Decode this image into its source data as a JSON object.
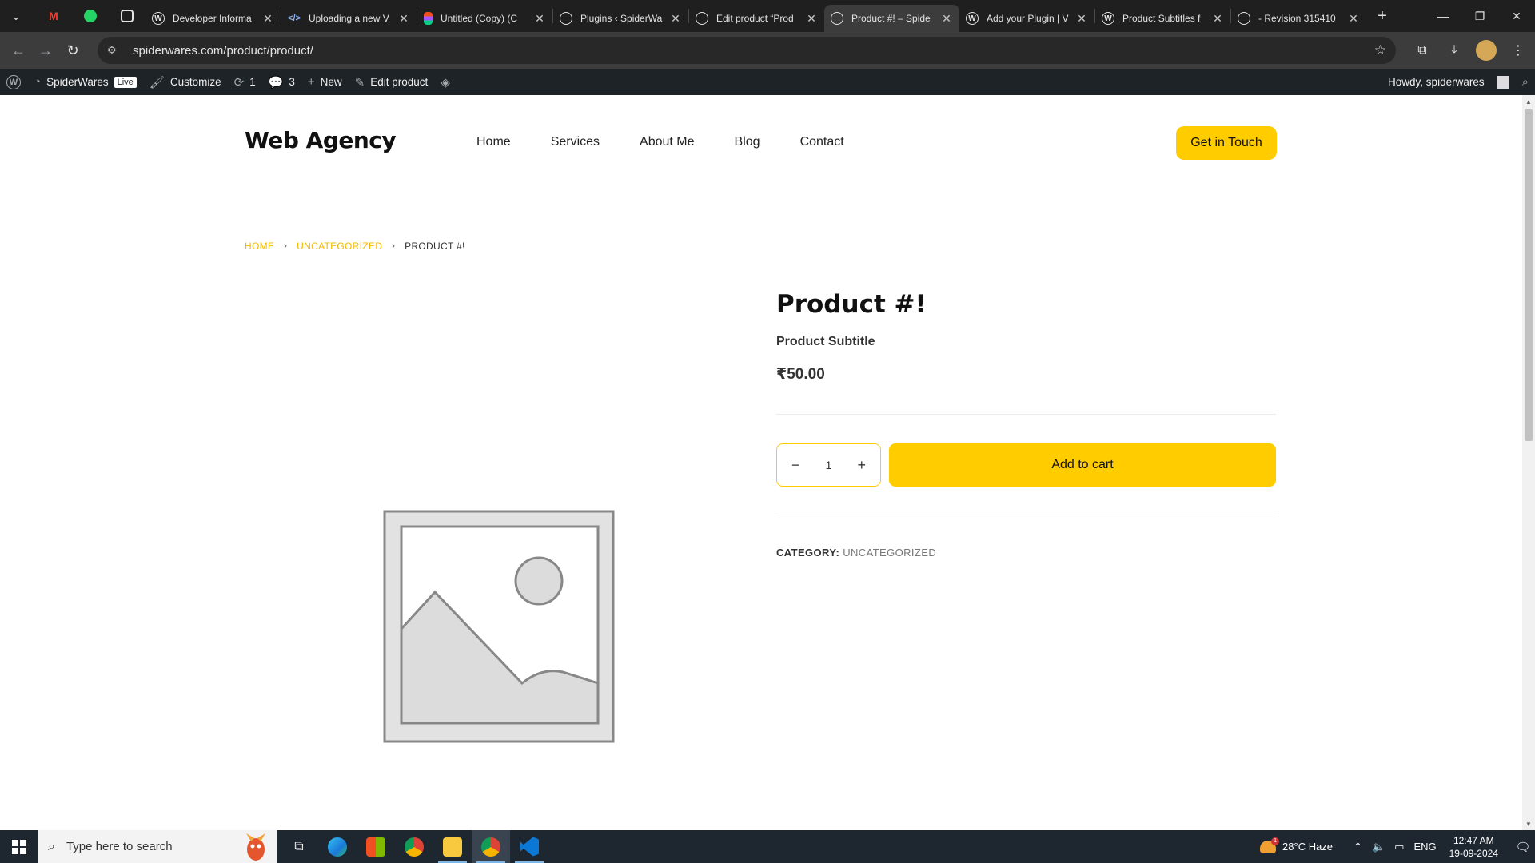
{
  "browser": {
    "tabs": [
      {
        "title": "",
        "type": "pinned",
        "icon": "gmail-icon"
      },
      {
        "title": "",
        "type": "pinned",
        "icon": "whatsapp-icon"
      },
      {
        "title": "",
        "type": "pinned",
        "icon": "chatgpt-icon"
      },
      {
        "title": "Developer Informa",
        "icon": "wordpress-icon"
      },
      {
        "title": "Uploading a new V",
        "icon": "code-icon"
      },
      {
        "title": "Untitled (Copy) (C",
        "icon": "figma-icon"
      },
      {
        "title": "Plugins ‹ SpiderWa",
        "icon": "globe-icon"
      },
      {
        "title": "Edit product “Prod",
        "icon": "globe-icon"
      },
      {
        "title": "Product #! – Spide",
        "icon": "globe-icon",
        "active": true
      },
      {
        "title": "Add your Plugin | V",
        "icon": "wordpress-icon"
      },
      {
        "title": "Product Subtitles f",
        "icon": "wordpress-icon"
      },
      {
        "title": "- Revision 315410",
        "icon": "globe-icon"
      }
    ],
    "url": "spiderwares.com/product/product/"
  },
  "adminbar": {
    "site_name": "SpiderWares",
    "live_badge": "Live",
    "customize": "Customize",
    "updates_count": "1",
    "comments_count": "3",
    "new_label": "New",
    "edit_label": "Edit product",
    "howdy": "Howdy, spiderwares"
  },
  "site": {
    "logo": "Web Agency",
    "nav": [
      "Home",
      "Services",
      "About Me",
      "Blog",
      "Contact"
    ],
    "cta": "Get in Touch"
  },
  "breadcrumb": {
    "home": "HOME",
    "category": "UNCATEGORIZED",
    "current": "PRODUCT #!"
  },
  "product": {
    "title": "Product #!",
    "subtitle": "Product Subtitle",
    "price": "₹50.00",
    "quantity": "1",
    "add_to_cart": "Add to cart",
    "category_label": "CATEGORY:",
    "category_value": "UNCATEGORIZED"
  },
  "taskbar": {
    "search_placeholder": "Type here to search",
    "weather": "28°C  Haze",
    "weather_badge": "1",
    "language": "ENG",
    "time": "12:47 AM",
    "date": "19-09-2024"
  },
  "colors": {
    "accent": "#ffcc00",
    "adminbar": "#1d2327",
    "tabbar": "#1f1f1f"
  }
}
